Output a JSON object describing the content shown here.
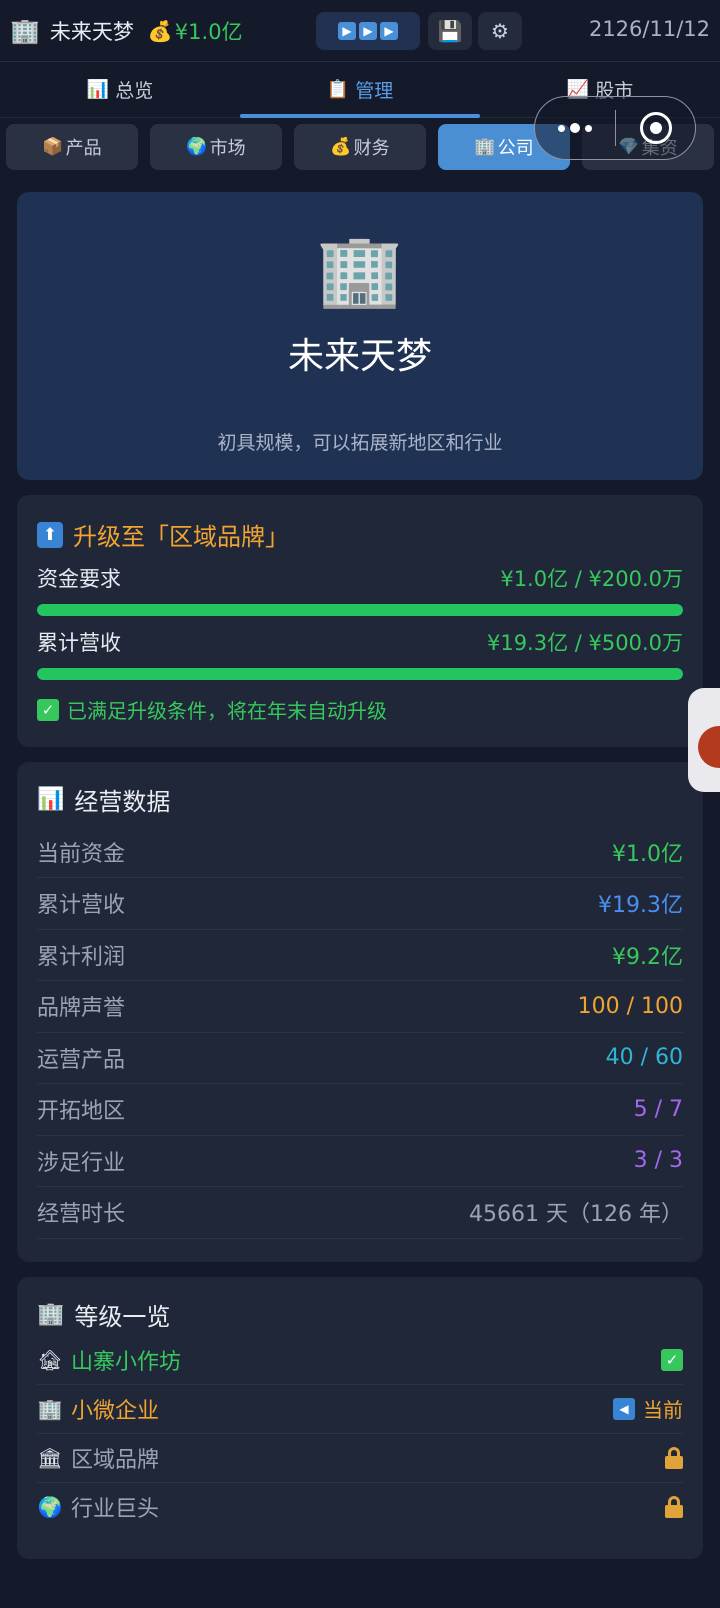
{
  "header": {
    "company_icon": "office-building-icon",
    "company_name": "未来天梦",
    "money_icon": "money-bag-icon",
    "money": "¥1.0亿",
    "speed_icon": "fast-forward-icon",
    "save_icon": "floppy-disk-icon",
    "settings_icon": "gear-icon",
    "date": "2126/11/12"
  },
  "main_tabs": [
    {
      "label": "总览",
      "icon": "bar-chart-icon",
      "active": false
    },
    {
      "label": "管理",
      "icon": "clipboard-icon",
      "active": true
    },
    {
      "label": "股市",
      "icon": "chart-up-icon",
      "active": false
    }
  ],
  "sub_tabs": [
    {
      "label": "产品",
      "icon": "package-icon",
      "active": false
    },
    {
      "label": "市场",
      "icon": "globe-icon",
      "active": false
    },
    {
      "label": "财务",
      "icon": "money-bag-icon",
      "active": false
    },
    {
      "label": "公司",
      "icon": "office-building-icon",
      "active": true
    },
    {
      "label": "集资",
      "icon": "gem-icon",
      "active": false
    }
  ],
  "hero": {
    "icon": "office-building-icon",
    "title": "未来天梦",
    "description": "初具规模，可以拓展新地区和行业"
  },
  "upgrade": {
    "title": "升级至「区域品牌」",
    "icon": "up-arrow-icon",
    "requirements": [
      {
        "label": "资金要求",
        "value": "¥1.0亿 / ¥200.0万",
        "progress": 1.0
      },
      {
        "label": "累计营收",
        "value": "¥19.3亿 / ¥500.0万",
        "progress": 1.0
      }
    ],
    "note": "已满足升级条件，将在年末自动升级"
  },
  "stats": {
    "title": "经营数据",
    "icon": "bar-chart-icon",
    "rows": [
      {
        "label": "当前资金",
        "value": "¥1.0亿",
        "color": "#36c85c"
      },
      {
        "label": "累计营收",
        "value": "¥19.3亿",
        "color": "#4a8ef0"
      },
      {
        "label": "累计利润",
        "value": "¥9.2亿",
        "color": "#36c85c"
      },
      {
        "label": "品牌声誉",
        "value": "100 / 100",
        "color": "#f0a431"
      },
      {
        "label": "运营产品",
        "value": "40 / 60",
        "color": "#2eb6d6"
      },
      {
        "label": "开拓地区",
        "value": "5 / 7",
        "color": "#a368f0"
      },
      {
        "label": "涉足行业",
        "value": "3 / 3",
        "color": "#a368f0"
      },
      {
        "label": "经营时长",
        "value": "45661 天（126 年）",
        "color": "#9aa3b5"
      }
    ]
  },
  "levels": {
    "title": "等级一览",
    "icon": "office-building-icon",
    "rows": [
      {
        "label": "山寨小作坊",
        "icon": "house-icon",
        "status": "done",
        "color": "#36c85c"
      },
      {
        "label": "小微企业",
        "icon": "office-building-icon",
        "status": "current",
        "status_text": "当前",
        "color": "#f0a431"
      },
      {
        "label": "区域品牌",
        "icon": "classical-building-icon",
        "status": "locked",
        "color": "#9aa3b5"
      },
      {
        "label": "行业巨头",
        "icon": "globe-icon",
        "status": "locked",
        "color": "#9aa3b5"
      }
    ]
  }
}
